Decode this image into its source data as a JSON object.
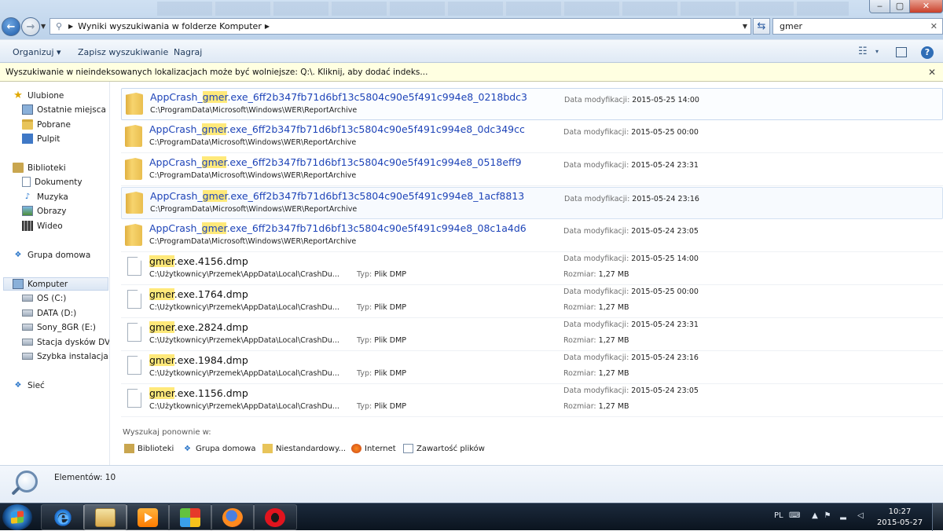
{
  "window": {
    "min": "‒",
    "max": "▢",
    "close": "✕"
  },
  "address": {
    "path": "Wyniki wyszukiwania w folderze Komputer"
  },
  "search": {
    "value": "gmer",
    "clear": "✕"
  },
  "toolbar": {
    "organize": "Organizuj ▾",
    "save_search": "Zapisz wyszukiwanie",
    "burn": "Nagraj",
    "help": "?"
  },
  "infobar": {
    "text": "Wyszukiwanie w nieindeksowanych lokalizacjach może być wolniejsze: Q:\\. Kliknij, aby dodać indeks...",
    "close": "✕"
  },
  "sidebar": {
    "favorites": {
      "label": "Ulubione",
      "items": [
        "Ostatnie miejsca",
        "Pobrane",
        "Pulpit"
      ]
    },
    "libraries": {
      "label": "Biblioteki",
      "items": [
        "Dokumenty",
        "Muzyka",
        "Obrazy",
        "Wideo"
      ]
    },
    "homegroup": "Grupa domowa",
    "computer": {
      "label": "Komputer",
      "items": [
        "OS (C:)",
        "DATA (D:)",
        "Sony_8GR (E:)",
        "Stacja dysków DVD F",
        "Szybka instalacja pal"
      ]
    },
    "network": "Sieć"
  },
  "labels": {
    "date_modified": "Data modyfikacji:",
    "type": "Typ:",
    "size": "Rozmiar:"
  },
  "files": [
    {
      "pre": "AppCrash_",
      "hit": "gmer",
      "post": ".exe_6ff2b347fb71d6bf13c5804c90e5f491c994e8_0218bdc3",
      "path": "C:\\ProgramData\\Microsoft\\Windows\\WER\\ReportArchive",
      "date": "2015-05-25 14:00"
    },
    {
      "pre": "AppCrash_",
      "hit": "gmer",
      "post": ".exe_6ff2b347fb71d6bf13c5804c90e5f491c994e8_0dc349cc",
      "path": "C:\\ProgramData\\Microsoft\\Windows\\WER\\ReportArchive",
      "date": "2015-05-25 00:00"
    },
    {
      "pre": "AppCrash_",
      "hit": "gmer",
      "post": ".exe_6ff2b347fb71d6bf13c5804c90e5f491c994e8_0518eff9",
      "path": "C:\\ProgramData\\Microsoft\\Windows\\WER\\ReportArchive",
      "date": "2015-05-24 23:31"
    },
    {
      "pre": "AppCrash_",
      "hit": "gmer",
      "post": ".exe_6ff2b347fb71d6bf13c5804c90e5f491c994e8_1acf8813",
      "path": "C:\\ProgramData\\Microsoft\\Windows\\WER\\ReportArchive",
      "date": "2015-05-24 23:16"
    },
    {
      "pre": "AppCrash_",
      "hit": "gmer",
      "post": ".exe_6ff2b347fb71d6bf13c5804c90e5f491c994e8_08c1a4d6",
      "path": "C:\\ProgramData\\Microsoft\\Windows\\WER\\ReportArchive",
      "date": "2015-05-24 23:05"
    },
    {
      "pre": "",
      "hit": "gmer",
      "post": ".exe.4156.dmp",
      "path": "C:\\Użytkownicy\\Przemek\\AppData\\Local\\CrashDu...",
      "type": "Plik DMP",
      "date": "2015-05-25 14:00",
      "size": "1,27 MB"
    },
    {
      "pre": "",
      "hit": "gmer",
      "post": ".exe.1764.dmp",
      "path": "C:\\Użytkownicy\\Przemek\\AppData\\Local\\CrashDu...",
      "type": "Plik DMP",
      "date": "2015-05-25 00:00",
      "size": "1,27 MB"
    },
    {
      "pre": "",
      "hit": "gmer",
      "post": ".exe.2824.dmp",
      "path": "C:\\Użytkownicy\\Przemek\\AppData\\Local\\CrashDu...",
      "type": "Plik DMP",
      "date": "2015-05-24 23:31",
      "size": "1,27 MB"
    },
    {
      "pre": "",
      "hit": "gmer",
      "post": ".exe.1984.dmp",
      "path": "C:\\Użytkownicy\\Przemek\\AppData\\Local\\CrashDu...",
      "type": "Plik DMP",
      "date": "2015-05-24 23:16",
      "size": "1,27 MB"
    },
    {
      "pre": "",
      "hit": "gmer",
      "post": ".exe.1156.dmp",
      "path": "C:\\Użytkownicy\\Przemek\\AppData\\Local\\CrashDu...",
      "type": "Plik DMP",
      "date": "2015-05-24 23:05",
      "size": "1,27 MB"
    }
  ],
  "search_again": {
    "label": "Wyszukaj ponownie w:",
    "items": [
      "Biblioteki",
      "Grupa domowa",
      "Niestandardowy...",
      "Internet",
      "Zawartość plików"
    ]
  },
  "details": {
    "count": "Elementów: 10"
  },
  "taskbar": {
    "lang": "PL",
    "time": "10:27",
    "date": "2015-05-27"
  },
  "icons": {
    "address": "magnifier-folder-icon",
    "refresh": "⇆",
    "view": "☷",
    "view_dd": "▾"
  }
}
